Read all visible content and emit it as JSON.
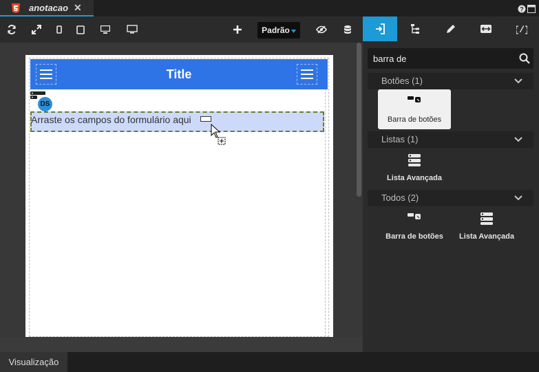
{
  "tab": {
    "title": "anotacao",
    "close": "✕"
  },
  "toolbar": {
    "mode_select": "Padrão"
  },
  "canvas": {
    "header_title": "Title",
    "badge": "DS",
    "dropzone_text": "Arraste os campos do formulário aqui"
  },
  "search": {
    "value": "barra de"
  },
  "categories": [
    {
      "label": "Botões (1)",
      "items": [
        "Barra de botões"
      ]
    },
    {
      "label": "Listas (1)",
      "items": [
        "Lista Avançada"
      ]
    },
    {
      "label": "Todos (2)",
      "items": [
        "Barra de botões",
        "Lista Avançada"
      ]
    }
  ],
  "bottom": {
    "tab": "Visualização"
  },
  "colors": {
    "accent": "#1e9ad6",
    "header_blue": "#2f74e6",
    "dropzone": "#ccd9fb",
    "selected_card": "#f0f0f0"
  }
}
